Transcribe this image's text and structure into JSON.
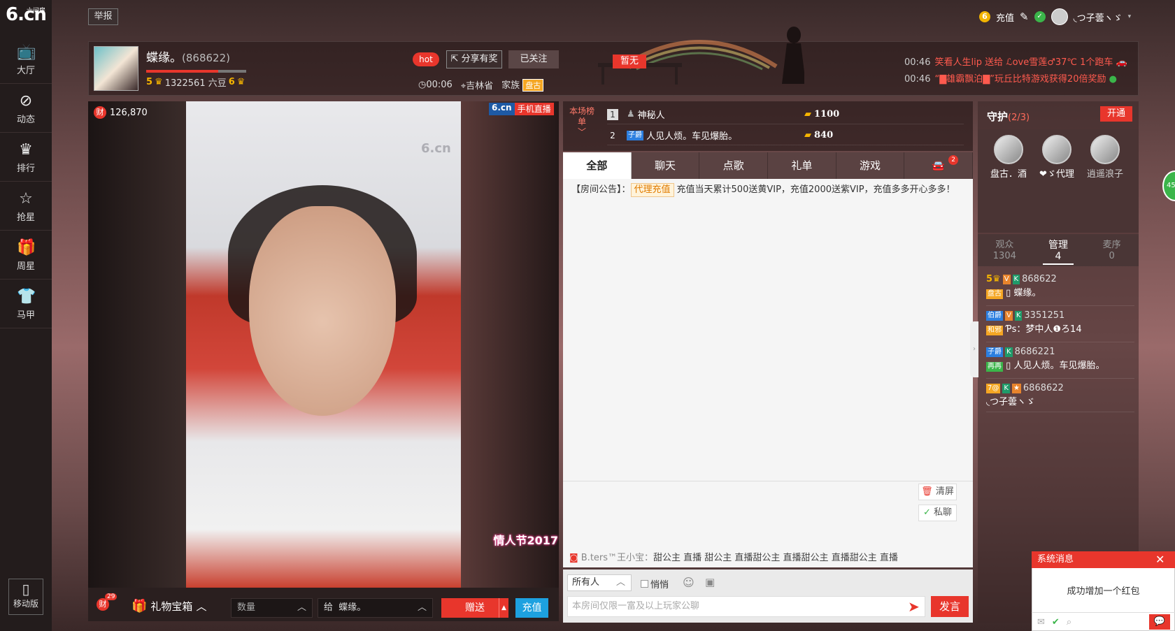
{
  "site": {
    "logo_main": "6.cn",
    "logo_sub": "六间房"
  },
  "leftnav": {
    "items": [
      {
        "label": "大厅",
        "icon": "tv-icon"
      },
      {
        "label": "动态",
        "icon": "compass-icon"
      },
      {
        "label": "排行",
        "icon": "crown-icon"
      },
      {
        "label": "抢星",
        "icon": "star-icon"
      },
      {
        "label": "周星",
        "icon": "gift-icon"
      },
      {
        "label": "马甲",
        "icon": "shirt-icon"
      }
    ],
    "mobile_label": "移动版"
  },
  "topbar": {
    "report_label": "举报",
    "recharge_label": "充值",
    "username": "◟つ子蕓ヽゞ"
  },
  "anchor": {
    "name": "蝶缘。",
    "room_id": "(868622)",
    "level_left": "5",
    "beans": "1322561 六豆",
    "level_right": "6",
    "hot_label": "hot",
    "share_label": "分享有奖",
    "follow_label": "已关注",
    "duration": "00:06",
    "location": "吉林省",
    "family_label": "家族",
    "family_badge": "盘古"
  },
  "banner": {
    "zanwu_label": "暂无",
    "ticker": [
      {
        "time": "00:46",
        "text": "笑看人生lip 送给 ℒove雪莲♂37℃ 1个跑车"
      },
      {
        "time": "00:46",
        "text": "“▇雄霸飘泊▇”玩丘比特游戏获得20倍奖励"
      }
    ]
  },
  "video": {
    "wealth": "126,870",
    "wealth_icon": "财",
    "brand": "6.cn",
    "mobile_live": "手机直播",
    "watermark": "6.cn",
    "sticker": "情人节2017"
  },
  "giftbar": {
    "cai_count": "29",
    "cai_icon": "财",
    "giftbox_label": "礼物宝箱",
    "qty_placeholder": "数量",
    "to_label": "给",
    "to_name": "蝶缘。",
    "send_label": "赠送",
    "recharge_label": "充值"
  },
  "rank": {
    "label": "本场榜单",
    "rows": [
      {
        "n": "1",
        "name": "神秘人",
        "score": "1100"
      },
      {
        "n": "2",
        "name": "人见人烦。车见爆胎。",
        "score": "840"
      }
    ]
  },
  "chat": {
    "tabs": [
      "全部",
      "聊天",
      "点歌",
      "礼单",
      "游戏",
      ""
    ],
    "car_badge": "2",
    "notice_prefix": "【房间公告】：",
    "notice_link": "代理充值",
    "notice_text": "充值当天累计500送黄VIP，充值2000送紫VIP，充值多多开心多多！",
    "clear_label": "清屏",
    "pm_label": "私聊",
    "broadcast_who": "B.ters™王小宝：",
    "broadcast_text": "甜公主 直播 甜公主 直播甜公主 直播甜公主 直播甜公主 直播",
    "target_label": "所有人",
    "whisper_label": "悄悄",
    "input_placeholder": "本房间仅限一富及以上玩家公聊",
    "speak_label": "发言"
  },
  "guard": {
    "title": "守护",
    "count": "(2/3)",
    "open_label": "开通",
    "members": [
      "盘古．酒",
      "❤ゞ代理",
      "逍遥浪子"
    ]
  },
  "audience_tabs": [
    {
      "label": "观众",
      "count": "1304"
    },
    {
      "label": "管理",
      "count": "4"
    },
    {
      "label": "麦序",
      "count": "0"
    }
  ],
  "managers": [
    {
      "id": "868622",
      "name": "蝶缘。",
      "tag": "盘古"
    },
    {
      "id": "3351251",
      "name": "Ƥs：梦中人❶ろ14",
      "tag": "和邪"
    },
    {
      "id": "8686221",
      "name": "人见人烦。车见爆胎。",
      "tag": "再再"
    },
    {
      "id": "6868622",
      "name": "◟つ子蕓ヽゞ",
      "tag": "7@"
    }
  ],
  "sysmsg": {
    "title": "系统消息",
    "body": "成功增加一个红包"
  },
  "side_bubble": "45"
}
